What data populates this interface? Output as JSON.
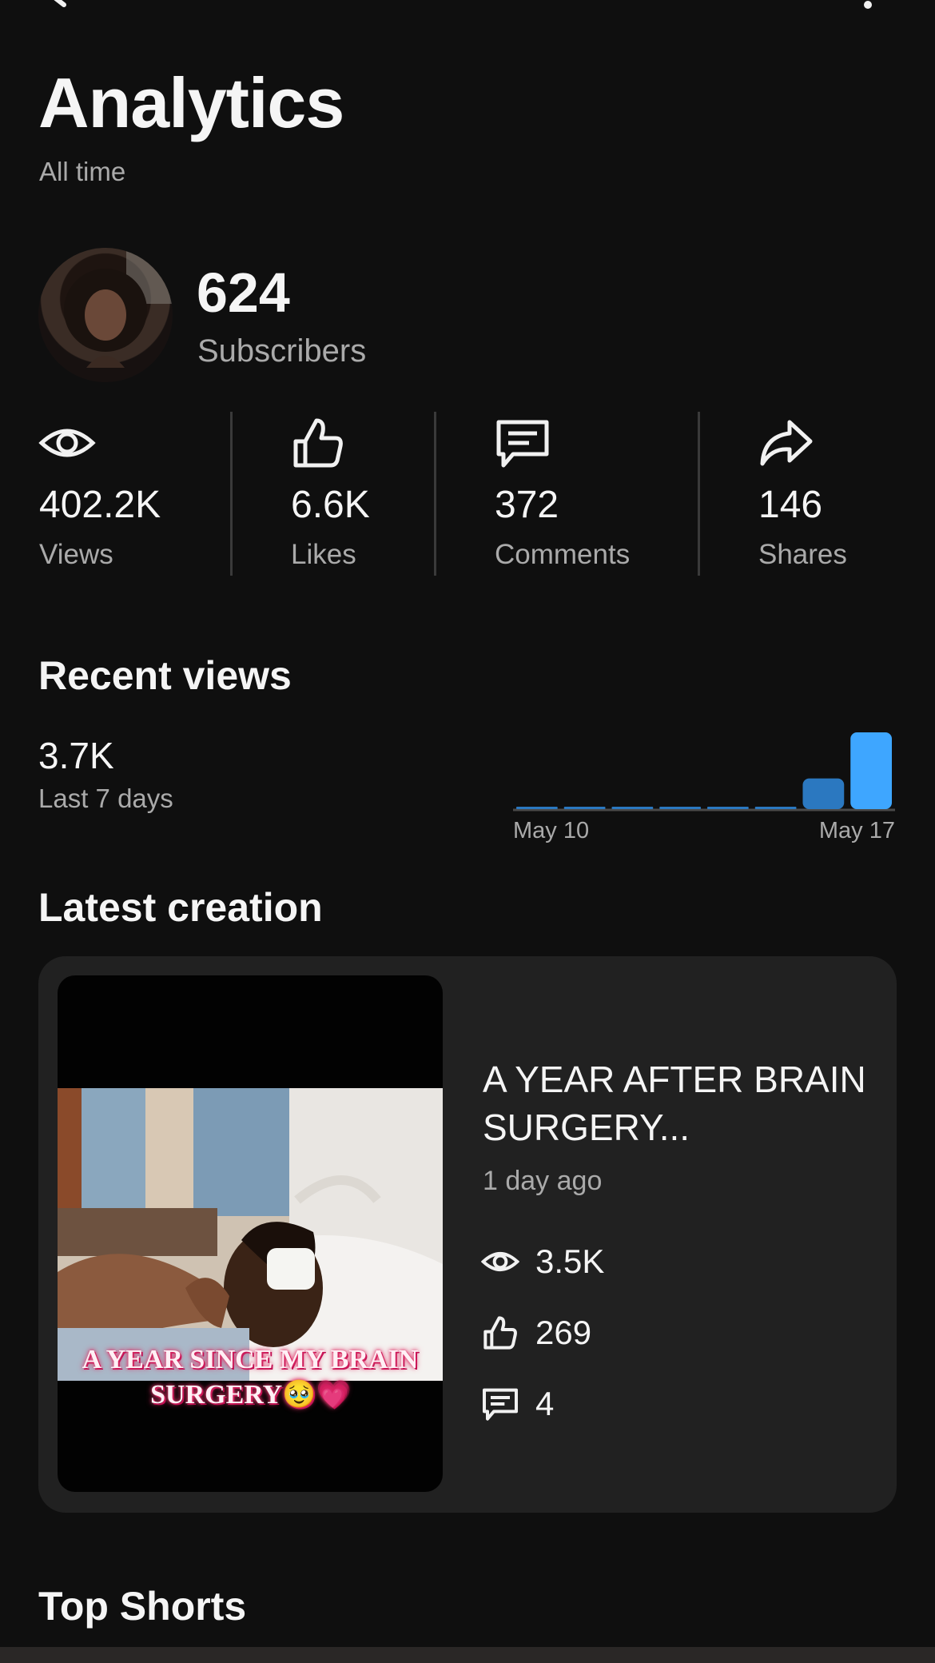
{
  "page": {
    "title": "Analytics",
    "period": "All time"
  },
  "channel": {
    "subscribers_count": "624",
    "subscribers_label": "Subscribers"
  },
  "stats": [
    {
      "icon": "eye-icon",
      "value": "402.2K",
      "label": "Views"
    },
    {
      "icon": "thumbs-up-icon",
      "value": "6.6K",
      "label": "Likes"
    },
    {
      "icon": "comment-icon",
      "value": "372",
      "label": "Comments"
    },
    {
      "icon": "share-icon",
      "value": "146",
      "label": "Shares"
    }
  ],
  "recent_views": {
    "section_title": "Recent views",
    "value": "3.7K",
    "label": "Last 7 days"
  },
  "chart_data": {
    "type": "bar",
    "x_start_label": "May 10",
    "x_end_label": "May 17",
    "values": [
      0.02,
      0.02,
      0.02,
      0.02,
      0.02,
      0.02,
      0.4,
      1.0
    ],
    "colors": {
      "bar": "#3ea6ff",
      "bar_dim": "#2b78c0",
      "baseline": "#4a4a4a"
    }
  },
  "latest_creation": {
    "section_title": "Latest creation",
    "video_title": "A YEAR AFTER BRAIN SURGERY...",
    "age": "1 day ago",
    "thumbnail_caption_line1": "A YEAR SINCE MY BRAIN",
    "thumbnail_caption_line2": "SURGERY🥹💗",
    "views": "3.5K",
    "likes": "269",
    "comments": "4"
  },
  "top_shorts": {
    "section_title": "Top Shorts"
  }
}
